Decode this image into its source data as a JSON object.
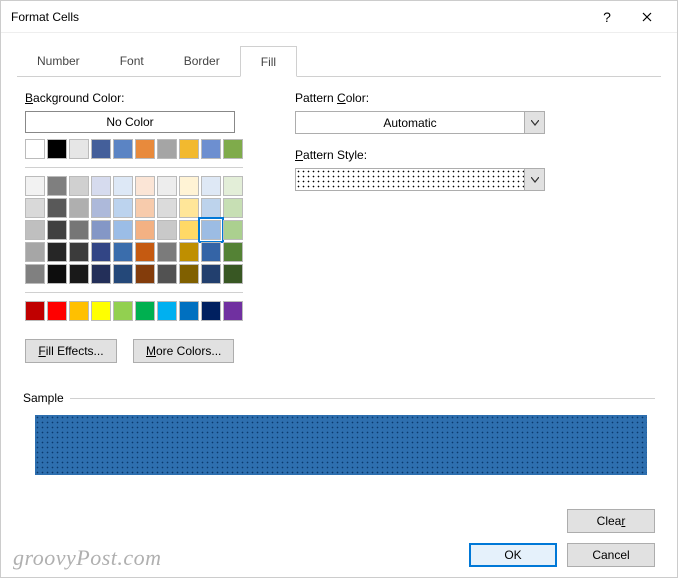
{
  "window": {
    "title": "Format Cells"
  },
  "tabs": {
    "items": [
      "Number",
      "Font",
      "Border",
      "Fill"
    ],
    "active": "Fill"
  },
  "labels": {
    "background_color": "Background Color:",
    "no_color": "No Color",
    "pattern_color": "Pattern Color:",
    "pattern_style": "Pattern Style:",
    "sample": "Sample"
  },
  "pattern_color": {
    "value": "Automatic"
  },
  "buttons": {
    "fill_effects": "Fill Effects...",
    "more_colors": "More Colors...",
    "clear": "Clear",
    "ok": "OK",
    "cancel": "Cancel"
  },
  "colors": {
    "row_basic": [
      "#ffffff",
      "#000000",
      "#e6e6e6",
      "#445f9a",
      "#5b84c4",
      "#e88a3c",
      "#a5a5a5",
      "#f2b92f",
      "#6d8fd0",
      "#7fab4b"
    ],
    "theme": [
      [
        "#f2f2f2",
        "#7f7f7f",
        "#d0d0d0",
        "#d6dbee",
        "#dde8f6",
        "#fbe5d6",
        "#ededed",
        "#fff3d5",
        "#dee8f5",
        "#e3eed8"
      ],
      [
        "#d9d9d9",
        "#595959",
        "#afafaf",
        "#adb9da",
        "#bcd3ee",
        "#f7cbac",
        "#dbdbdb",
        "#ffe699",
        "#bdd3ec",
        "#c7dfb4"
      ],
      [
        "#bfbfbf",
        "#404040",
        "#767676",
        "#8497c6",
        "#9bbde6",
        "#f3b183",
        "#c9c9c9",
        "#ffd966",
        "#9cbce3",
        "#abd08f"
      ],
      [
        "#a6a6a6",
        "#262626",
        "#3b3b3b",
        "#324585",
        "#3a6dac",
        "#c55a11",
        "#7b7b7b",
        "#bf8f00",
        "#3464a6",
        "#548235"
      ],
      [
        "#808080",
        "#0d0d0d",
        "#191919",
        "#232f59",
        "#244879",
        "#833c0b",
        "#525252",
        "#806000",
        "#223f6e",
        "#385723"
      ]
    ],
    "standard": [
      "#c00000",
      "#ff0000",
      "#ffc000",
      "#ffff00",
      "#92d050",
      "#00b050",
      "#00b0f0",
      "#0070c0",
      "#002060",
      "#7030a0"
    ],
    "selected": "#9cbce3"
  },
  "sample": {
    "fill": "#2e6faf",
    "pattern": "dotted"
  },
  "watermark": "groovyPost.com"
}
